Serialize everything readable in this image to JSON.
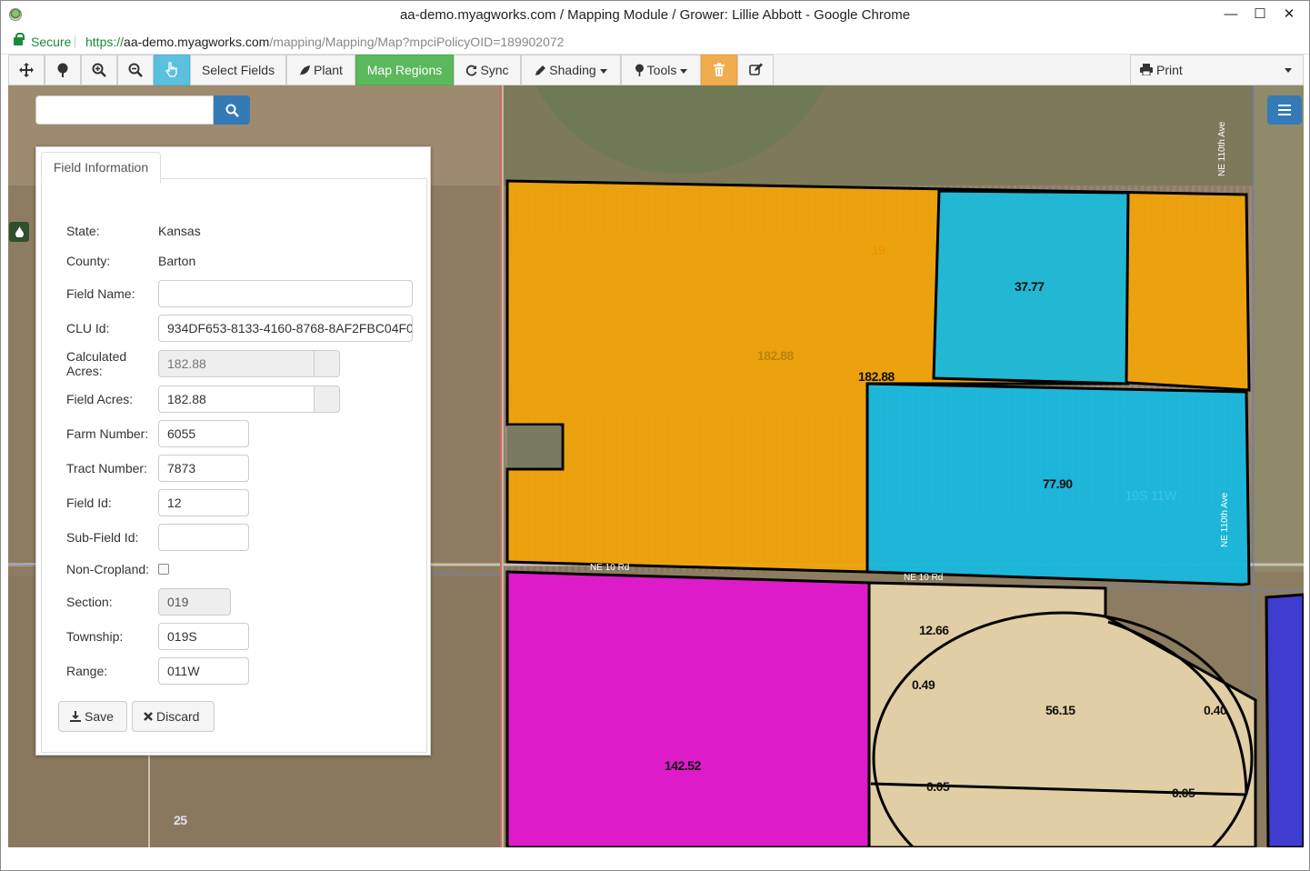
{
  "window": {
    "title": "aa-demo.myagworks.com / Mapping Module / Grower: Lillie Abbott - Google Chrome",
    "minimize": "—",
    "maximize": "☐",
    "close": "✕"
  },
  "address": {
    "secure_label": "Secure",
    "url_scheme": "https://",
    "url_host": "aa-demo.myagworks.com",
    "url_path": "/mapping/Mapping/Map?mpciPolicyOID=189902072"
  },
  "toolbar": {
    "select_fields": "Select Fields",
    "plant": "Plant",
    "map_regions": "Map Regions",
    "sync": "Sync",
    "shading": "Shading",
    "tools": "Tools",
    "print": "Print",
    "icons": [
      "move-icon",
      "tree-icon",
      "zoom-in-icon",
      "zoom-out-icon",
      "pointer-icon",
      "trash-icon",
      "edit-icon"
    ]
  },
  "search": {
    "placeholder": ""
  },
  "panel": {
    "tab_label": "Field Information",
    "state_label": "State:",
    "state_value": "Kansas",
    "county_label": "County:",
    "county_value": "Barton",
    "field_name_label": "Field Name:",
    "field_name_value": "",
    "clu_label": "CLU Id:",
    "clu_value": "934DF653-8133-4160-8768-8AF2FBC04F0",
    "calc_acres_label_1": "Calculated",
    "calc_acres_label_2": "Acres:",
    "calc_acres_value": "182.88",
    "field_acres_label": "Field Acres:",
    "field_acres_value": "182.88",
    "farm_number_label": "Farm Number:",
    "farm_number_value": "6055",
    "tract_number_label": "Tract Number:",
    "tract_number_value": "7873",
    "field_id_label": "Field Id:",
    "field_id_value": "12",
    "subfield_label": "Sub-Field Id:",
    "subfield_value": "",
    "noncropland_label": "Non-Cropland:",
    "noncropland_checked": false,
    "section_label": "Section:",
    "section_value": "019",
    "township_label": "Township:",
    "township_value": "019S",
    "range_label": "Range:",
    "range_value": "011W",
    "save_label": "Save",
    "discard_label": "Discard"
  },
  "map": {
    "labels": {
      "orange_acres_faint": "182.88",
      "orange_acres": "182.88",
      "section_number": "19",
      "cyan_top": "37.77",
      "cyan_bottom": "77.90",
      "township_range": "19S 11W",
      "magenta": "142.52",
      "tan_top": "12.66",
      "tan_left": "0.49",
      "tan_center": "56.15",
      "tan_right": "0.40",
      "tan_bottom_left": "0.05",
      "tan_bottom_right": "0.05",
      "corner_section": "25"
    },
    "roads": {
      "road_a": "NE 10 Rd",
      "road_b": "NE 10 Rd",
      "ave_a": "NE 110th Ave",
      "ave_b": "NE 110th Ave"
    },
    "colors": {
      "orange": "#f0a30a",
      "cyan": "#17b8de",
      "magenta": "#e316cf",
      "tan": "#e6d3a8",
      "blue": "#3a3ad6",
      "toolbar_green": "#5cb85c",
      "toolbar_blue": "#5bc0de",
      "toolbar_orange": "#f0ad4e"
    }
  }
}
